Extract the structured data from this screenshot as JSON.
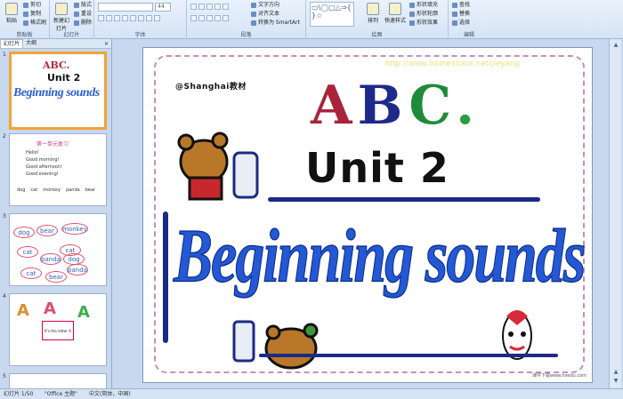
{
  "ribbon": {
    "clipboard": {
      "paste": "粘贴",
      "cut": "剪切",
      "copy": "复制",
      "format_painter": "格式刷",
      "label": "剪贴板"
    },
    "slides": {
      "new_slide": "新建幻灯片",
      "layout": "版式",
      "reset": "重设",
      "delete": "删除",
      "label": "幻灯片"
    },
    "font": {
      "name": "",
      "size": "44",
      "label": "字体"
    },
    "paragraph": {
      "label": "段落"
    },
    "text": {
      "direction": "文字方向",
      "align": "对齐文本",
      "smartart": "转换为 SmartArt"
    },
    "drawing": {
      "shapes": "▭\\◯□△⇒{ }☆",
      "arrange": "排列",
      "quick_styles": "快速样式",
      "fill": "形状填充",
      "outline": "形状轮廓",
      "effects": "形状效果",
      "label": "绘图"
    },
    "editing": {
      "find": "查找",
      "replace": "替换",
      "select": "选择",
      "label": "编辑"
    }
  },
  "pane": {
    "tab_slides": "幻灯片",
    "tab_outline": "大纲",
    "close": "×"
  },
  "thumbnails": [
    {
      "num": "1",
      "abc": "ABC.",
      "unit": "Unit 2",
      "title": "Beginning sounds",
      "selected": true
    },
    {
      "num": "2",
      "title": "第一单元复习",
      "lines": [
        "Hello!",
        "Good morning!",
        "Good afternoon!",
        "Good evening!"
      ],
      "words": [
        "dog",
        "cat",
        "monkey",
        "panda",
        "bear"
      ]
    },
    {
      "num": "3",
      "ovals": [
        "dog",
        "bear",
        "monkey",
        "cat",
        "panda",
        "cat",
        "dog",
        "cat",
        "bear",
        "panda"
      ]
    },
    {
      "num": "4",
      "letters": [
        "A",
        "A",
        "A"
      ],
      "caption": "It's the letter A"
    },
    {
      "num": "5"
    }
  ],
  "slide": {
    "url": "http://www.homeshare.net/jieyang",
    "brand": "@Shanghai教材",
    "abc": [
      "A",
      "B",
      "C",
      "."
    ],
    "unit": "Unit 2",
    "subtitle": "Beginning sounds",
    "footer": "课件下载www.hxedu.com"
  },
  "status": {
    "slide_count": "幻灯片 1/50",
    "theme": "\"Office 主题\"",
    "language": "中文(简体，中国)"
  },
  "colors": {
    "accent": "#2458d4",
    "abc_a": "#a8243a",
    "abc_b": "#1e2a8a",
    "abc_c": "#1f8b3a",
    "frame": "#c98fb6"
  }
}
